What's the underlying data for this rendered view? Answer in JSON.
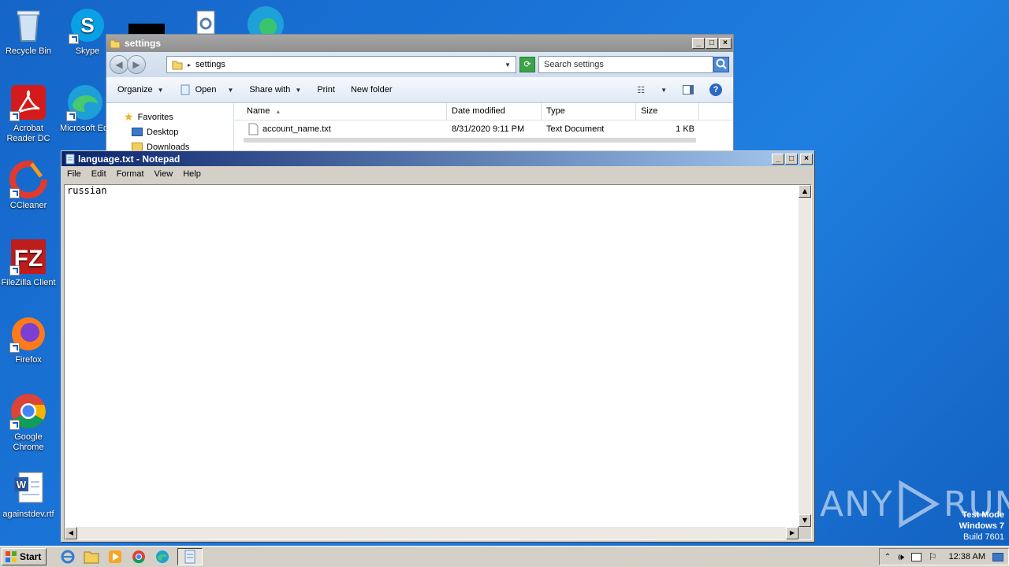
{
  "desktop": {
    "icons": [
      {
        "label": "Recycle Bin",
        "icon": "recycle-bin-icon"
      },
      {
        "label": "Skype",
        "icon": "skype-icon"
      },
      {
        "label": "Acrobat Reader DC",
        "icon": "acrobat-icon"
      },
      {
        "label": "Microsoft Ed",
        "icon": "edge-icon"
      },
      {
        "label": "CCleaner",
        "icon": "ccleaner-icon"
      },
      {
        "label": "FileZilla Client",
        "icon": "filezilla-icon"
      },
      {
        "label": "Firefox",
        "icon": "firefox-icon"
      },
      {
        "label": "Google Chrome",
        "icon": "chrome-icon"
      },
      {
        "label": "againstdev.rtf",
        "icon": "word-document-icon"
      }
    ]
  },
  "explorer": {
    "title": "settings",
    "address": "settings",
    "search_placeholder": "Search settings",
    "toolbar": {
      "organize": "Organize",
      "open": "Open",
      "share_with": "Share with",
      "print": "Print",
      "new_folder": "New folder"
    },
    "nav": {
      "favorites": "Favorites",
      "desktop": "Desktop",
      "downloads": "Downloads"
    },
    "columns": {
      "name": "Name",
      "date_modified": "Date modified",
      "type": "Type",
      "size": "Size"
    },
    "files": [
      {
        "name": "account_name.txt",
        "date": "8/31/2020 9:11 PM",
        "type": "Text Document",
        "size": "1 KB"
      }
    ]
  },
  "notepad": {
    "title": "language.txt - Notepad",
    "menu": {
      "file": "File",
      "edit": "Edit",
      "format": "Format",
      "view": "View",
      "help": "Help"
    },
    "content": "russian"
  },
  "taskbar": {
    "start": "Start",
    "clock": "12:38 AM"
  },
  "watermark": {
    "left": "ANY",
    "right": "RUN"
  },
  "testmode": {
    "line1": "Test Mode",
    "line2": "Windows 7",
    "line3": "Build 7601"
  },
  "colors": {
    "desktop": "#1a73d6",
    "notepad_title_start": "#0a246a",
    "notepad_title_end": "#a6caf0",
    "explorer_inactive_title": "#9a9a9a"
  }
}
